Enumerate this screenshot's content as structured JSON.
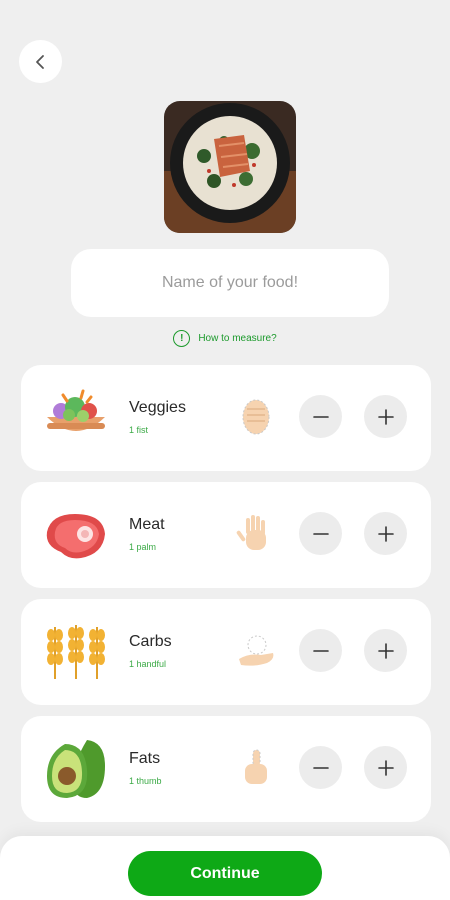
{
  "header": {
    "back_icon": "chevron-left-icon"
  },
  "food_photo": {
    "icon": "salmon-dish-photo"
  },
  "name_input": {
    "placeholder": "Name of your food!",
    "value": ""
  },
  "measure_link": {
    "label": "How to measure?",
    "icon": "info-icon"
  },
  "items": [
    {
      "name": "Veggies",
      "portion": "1 fist",
      "icon": "salad-bowl-icon",
      "hand_icon": "fist-icon"
    },
    {
      "name": "Meat",
      "portion": "1 palm",
      "icon": "steak-icon",
      "hand_icon": "palm-icon"
    },
    {
      "name": "Carbs",
      "portion": "1 handful",
      "icon": "wheat-icon",
      "hand_icon": "handful-icon"
    },
    {
      "name": "Fats",
      "portion": "1 thumb",
      "icon": "avocado-icon",
      "hand_icon": "thumb-icon"
    }
  ],
  "continue_button": {
    "label": "Continue"
  },
  "colors": {
    "accent": "#0ea916",
    "portion_text": "#3caa47",
    "background": "#efefef"
  }
}
